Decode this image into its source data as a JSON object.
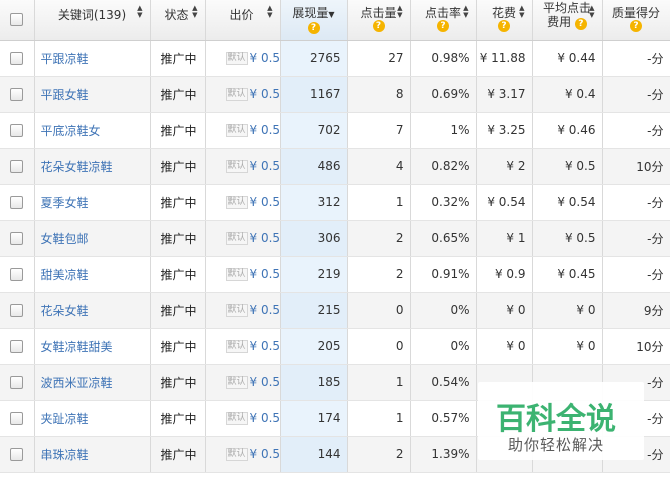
{
  "header": {
    "keyword": "关键词(139)",
    "status": "状态",
    "bid": "出价",
    "impressions": "展现量",
    "clicks": "点击量",
    "ctr": "点击率",
    "cost": "花费",
    "avg_cpc_line1": "平均点击",
    "avg_cpc_line2": "费用",
    "quality_score": "质量得分",
    "help_glyph": "?"
  },
  "default_tag": "默认",
  "rows": [
    {
      "keyword": "平跟凉鞋",
      "status": "推广中",
      "bid": "¥ 0.5",
      "impressions": "2765",
      "clicks": "27",
      "ctr": "0.98%",
      "cost": "¥ 11.88",
      "avg_cpc": "¥ 0.44",
      "quality_score": "-分"
    },
    {
      "keyword": "平跟女鞋",
      "status": "推广中",
      "bid": "¥ 0.5",
      "impressions": "1167",
      "clicks": "8",
      "ctr": "0.69%",
      "cost": "¥ 3.17",
      "avg_cpc": "¥ 0.4",
      "quality_score": "-分"
    },
    {
      "keyword": "平底凉鞋女",
      "status": "推广中",
      "bid": "¥ 0.5",
      "impressions": "702",
      "clicks": "7",
      "ctr": "1%",
      "cost": "¥ 3.25",
      "avg_cpc": "¥ 0.46",
      "quality_score": "-分"
    },
    {
      "keyword": "花朵女鞋凉鞋",
      "status": "推广中",
      "bid": "¥ 0.5",
      "impressions": "486",
      "clicks": "4",
      "ctr": "0.82%",
      "cost": "¥ 2",
      "avg_cpc": "¥ 0.5",
      "quality_score": "10分"
    },
    {
      "keyword": "夏季女鞋",
      "status": "推广中",
      "bid": "¥ 0.5",
      "impressions": "312",
      "clicks": "1",
      "ctr": "0.32%",
      "cost": "¥ 0.54",
      "avg_cpc": "¥ 0.54",
      "quality_score": "-分"
    },
    {
      "keyword": "女鞋包邮",
      "status": "推广中",
      "bid": "¥ 0.5",
      "impressions": "306",
      "clicks": "2",
      "ctr": "0.65%",
      "cost": "¥ 1",
      "avg_cpc": "¥ 0.5",
      "quality_score": "-分"
    },
    {
      "keyword": "甜美凉鞋",
      "status": "推广中",
      "bid": "¥ 0.5",
      "impressions": "219",
      "clicks": "2",
      "ctr": "0.91%",
      "cost": "¥ 0.9",
      "avg_cpc": "¥ 0.45",
      "quality_score": "-分"
    },
    {
      "keyword": "花朵女鞋",
      "status": "推广中",
      "bid": "¥ 0.5",
      "impressions": "215",
      "clicks": "0",
      "ctr": "0%",
      "cost": "¥ 0",
      "avg_cpc": "¥ 0",
      "quality_score": "9分"
    },
    {
      "keyword": "女鞋凉鞋甜美",
      "status": "推广中",
      "bid": "¥ 0.5",
      "impressions": "205",
      "clicks": "0",
      "ctr": "0%",
      "cost": "¥ 0",
      "avg_cpc": "¥ 0",
      "quality_score": "10分"
    },
    {
      "keyword": "波西米亚凉鞋",
      "status": "推广中",
      "bid": "¥ 0.5",
      "impressions": "185",
      "clicks": "1",
      "ctr": "0.54%",
      "cost": "",
      "avg_cpc": "",
      "quality_score": "-分"
    },
    {
      "keyword": "夹趾凉鞋",
      "status": "推广中",
      "bid": "¥ 0.5",
      "impressions": "174",
      "clicks": "1",
      "ctr": "0.57%",
      "cost": "",
      "avg_cpc": "",
      "quality_score": "-分"
    },
    {
      "keyword": "串珠凉鞋",
      "status": "推广中",
      "bid": "¥ 0.5",
      "impressions": "144",
      "clicks": "2",
      "ctr": "1.39%",
      "cost": "",
      "avg_cpc": "",
      "quality_score": "-分"
    }
  ],
  "watermark": {
    "title": "百科全说",
    "subtitle": "助你轻松解决"
  },
  "colors": {
    "link": "#3f74b6",
    "highlight_column": "#e9f3fc",
    "help_icon": "#f5b400",
    "watermark_green": "#3cb371"
  }
}
